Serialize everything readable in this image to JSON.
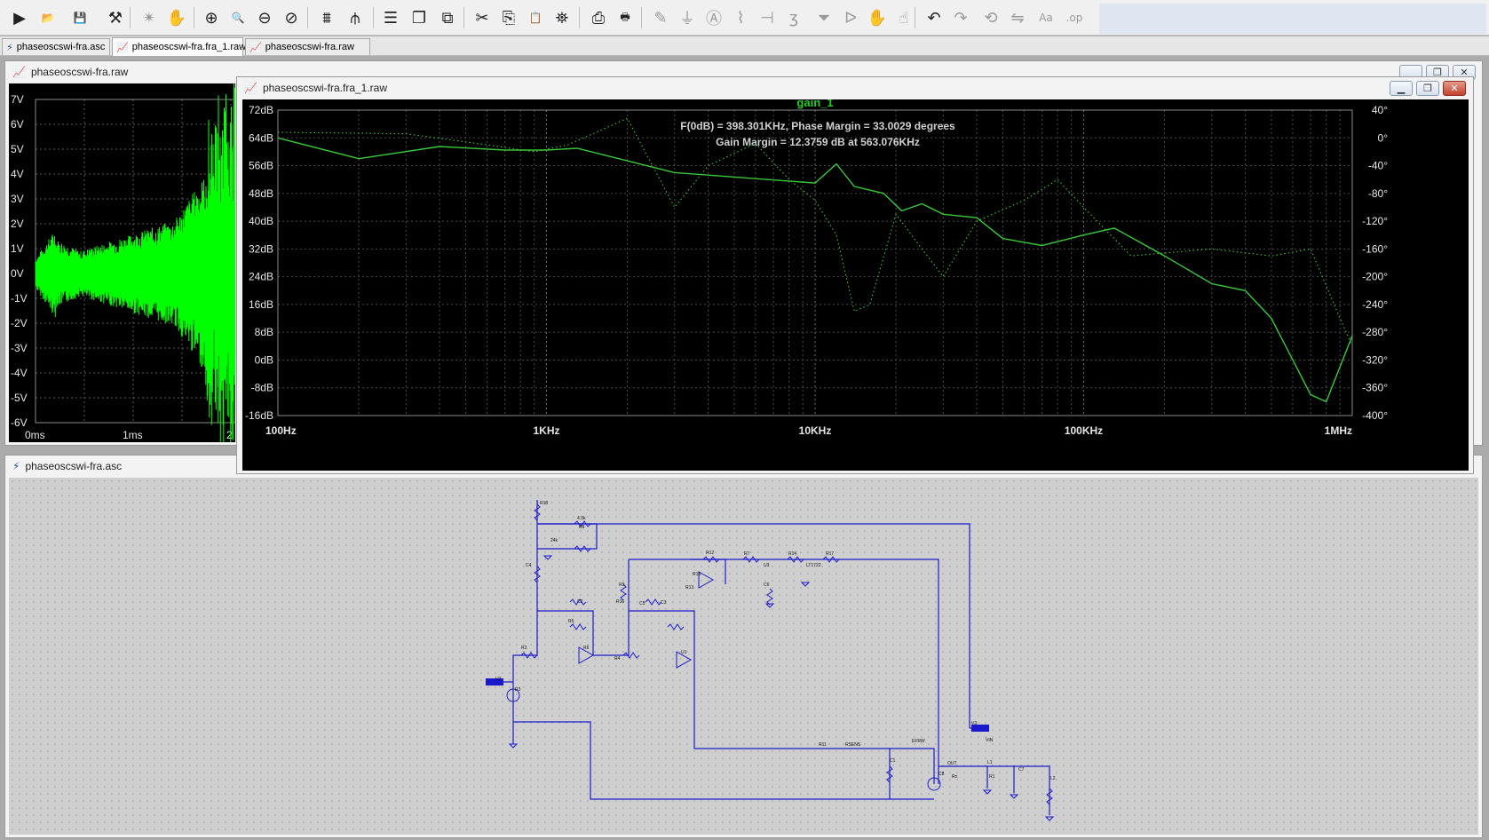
{
  "toolbar": {
    "buttons": [
      {
        "id": "run",
        "icon": "run-icon",
        "glyph": "▶",
        "x": 12,
        "enabled": true
      },
      {
        "id": "open",
        "icon": "open-folder-icon",
        "glyph": "📂",
        "x": 44,
        "enabled": true
      },
      {
        "id": "save",
        "icon": "save-icon",
        "glyph": "💾",
        "x": 80,
        "enabled": true
      },
      {
        "id": "control-panel",
        "icon": "hammer-icon",
        "glyph": "⚒",
        "x": 120,
        "enabled": true
      },
      {
        "id": "stop",
        "icon": "stop-running-icon",
        "glyph": "✴",
        "x": 158,
        "enabled": false
      },
      {
        "id": "pan",
        "icon": "pan-hand-icon",
        "glyph": "✋",
        "x": 189,
        "enabled": false
      },
      {
        "id": "zoom-in",
        "icon": "zoom-in-icon",
        "glyph": "⊕",
        "x": 228,
        "enabled": true
      },
      {
        "id": "zoom-area",
        "icon": "zoom-area-icon",
        "glyph": "🔍",
        "x": 258,
        "enabled": true
      },
      {
        "id": "zoom-out",
        "icon": "zoom-out-icon",
        "glyph": "⊖",
        "x": 288,
        "enabled": true
      },
      {
        "id": "zoom-fit",
        "icon": "zoom-fit-icon",
        "glyph": "⊘",
        "x": 318,
        "enabled": true
      },
      {
        "id": "autorange",
        "icon": "autorange-icon",
        "glyph": "⩩",
        "x": 358,
        "enabled": true
      },
      {
        "id": "add-trace",
        "icon": "add-trace-icon",
        "glyph": "⫛",
        "x": 390,
        "enabled": true
      },
      {
        "id": "tile-h",
        "icon": "tile-horizontal-icon",
        "glyph": "☰",
        "x": 430,
        "enabled": true
      },
      {
        "id": "cascade",
        "icon": "cascade-icon",
        "glyph": "❐",
        "x": 462,
        "enabled": true
      },
      {
        "id": "tile-v",
        "icon": "tile-vertical-icon",
        "glyph": "⧉",
        "x": 494,
        "enabled": true
      },
      {
        "id": "cut",
        "icon": "cut-icon",
        "glyph": "✂",
        "x": 533,
        "enabled": true
      },
      {
        "id": "copy",
        "icon": "copy-icon",
        "glyph": "⎘",
        "x": 563,
        "enabled": true
      },
      {
        "id": "paste",
        "icon": "paste-icon",
        "glyph": "📋",
        "x": 593,
        "enabled": true
      },
      {
        "id": "find",
        "icon": "find-binoculars-icon",
        "glyph": "⛯",
        "x": 623,
        "enabled": true
      },
      {
        "id": "print-setup",
        "icon": "print-setup-icon",
        "glyph": "⎙",
        "x": 664,
        "enabled": true
      },
      {
        "id": "print",
        "icon": "print-icon",
        "glyph": "🖶",
        "x": 694,
        "enabled": true
      },
      {
        "id": "draw-wire",
        "icon": "wire-pencil-icon",
        "glyph": "✎",
        "x": 734,
        "enabled": false
      },
      {
        "id": "ground",
        "icon": "ground-icon",
        "glyph": "⏚",
        "x": 764,
        "enabled": false
      },
      {
        "id": "label-net",
        "icon": "label-net-icon",
        "glyph": "Ⓐ",
        "x": 794,
        "enabled": false
      },
      {
        "id": "resistor",
        "icon": "resistor-icon",
        "glyph": "⌇",
        "x": 824,
        "enabled": false
      },
      {
        "id": "capacitor",
        "icon": "capacitor-icon",
        "glyph": "⊣",
        "x": 854,
        "enabled": false
      },
      {
        "id": "inductor",
        "icon": "inductor-icon",
        "glyph": "ʒ",
        "x": 884,
        "enabled": false
      },
      {
        "id": "diode",
        "icon": "diode-icon",
        "glyph": "⏷",
        "x": 918,
        "enabled": false
      },
      {
        "id": "component",
        "icon": "component-icon",
        "glyph": "ᐅ",
        "x": 948,
        "enabled": false
      },
      {
        "id": "move",
        "icon": "move-hand-icon",
        "glyph": "✋",
        "x": 978,
        "enabled": false
      },
      {
        "id": "drag",
        "icon": "drag-hand-icon",
        "glyph": "☝",
        "x": 1008,
        "enabled": false
      },
      {
        "id": "undo",
        "icon": "undo-icon",
        "glyph": "↶",
        "x": 1042,
        "enabled": true
      },
      {
        "id": "redo",
        "icon": "redo-icon",
        "glyph": "↷",
        "x": 1072,
        "enabled": false
      },
      {
        "id": "rotate",
        "icon": "rotate-icon",
        "glyph": "⟲",
        "x": 1106,
        "enabled": false
      },
      {
        "id": "mirror",
        "icon": "mirror-icon",
        "glyph": "⇋",
        "x": 1136,
        "enabled": false
      },
      {
        "id": "text",
        "icon": "text-icon",
        "glyph": "Aa",
        "x": 1168,
        "enabled": false
      },
      {
        "id": "spice-directive",
        "icon": "spice-directive-icon",
        "glyph": ".op",
        "x": 1200,
        "enabled": false
      }
    ],
    "separators": [
      146,
      218,
      346,
      420,
      522,
      652,
      722,
      1030
    ]
  },
  "tabs": [
    {
      "label": "phaseoscswi-fra.asc",
      "icon": "schematic-icon",
      "kind": "s",
      "active": false
    },
    {
      "label": "phaseoscswi-fra.fra_1.raw",
      "icon": "waveform-icon",
      "kind": "w",
      "active": true
    },
    {
      "label": "phaseoscswi-fra.raw",
      "icon": "waveform-icon",
      "kind": "w",
      "active": false
    }
  ],
  "windows": {
    "transient": {
      "title": "phaseoscswi-fra.raw"
    },
    "bode": {
      "title": "phaseoscswi-fra.fra_1.raw"
    },
    "schematic": {
      "title": "phaseoscswi-fra.asc"
    }
  },
  "transient_chart": {
    "type": "line",
    "ylabels": [
      "7V",
      "6V",
      "5V",
      "4V",
      "3V",
      "2V",
      "1V",
      "0V",
      "-1V",
      "-2V",
      "-3V",
      "-4V",
      "-5V",
      "-6V"
    ],
    "xlabels": [
      "0ms",
      "1ms",
      "2"
    ],
    "ylim": [
      -6,
      7
    ],
    "trace_color": "#00ff00"
  },
  "chart_data": {
    "type": "line",
    "title": "gain_1",
    "annotations": [
      "F(0dB) = 398.301KHz, Phase Margin = 33.0029 degrees",
      "Gain Margin = 12.3759 dB at 563.076KHz"
    ],
    "xscale": "log",
    "xlim": [
      100,
      1000000
    ],
    "xticks": [
      "100Hz",
      "1KHz",
      "10KHz",
      "100KHz",
      "1MHz"
    ],
    "ylim_left": [
      -16,
      72
    ],
    "yticks_left": [
      "72dB",
      "64dB",
      "56dB",
      "48dB",
      "40dB",
      "32dB",
      "24dB",
      "16dB",
      "8dB",
      "0dB",
      "-8dB",
      "-16dB"
    ],
    "ylim_right": [
      -400,
      40
    ],
    "yticks_right": [
      "40°",
      "0°",
      "-40°",
      "-80°",
      "-120°",
      "-160°",
      "-200°",
      "-240°",
      "-280°",
      "-320°",
      "-360°",
      "-400°"
    ],
    "grid": true,
    "series": [
      {
        "role": "magnitude",
        "axis": "left",
        "style": "solid",
        "color": "#38c838",
        "x": [
          100,
          200,
          400,
          700,
          1000,
          1300,
          3000,
          10000,
          12000,
          14000,
          18000,
          21000,
          25000,
          30000,
          40000,
          50000,
          70000,
          100000,
          130000,
          200000,
          300000,
          400000,
          500000,
          700000,
          800000,
          1000000
        ],
        "y": [
          64,
          58,
          61.5,
          60.5,
          60.5,
          61,
          54,
          51,
          56.5,
          50,
          48,
          43,
          45,
          42,
          41,
          35,
          33,
          36,
          38,
          30,
          22,
          20,
          12,
          -10,
          -12,
          7
        ]
      },
      {
        "role": "phase",
        "axis": "right",
        "style": "dotted",
        "color": "#38c838",
        "x": [
          100,
          300,
          600,
          900,
          1200,
          2000,
          3000,
          4000,
          6000,
          8000,
          10000,
          12000,
          14000,
          16000,
          20000,
          25000,
          30000,
          40000,
          60000,
          80000,
          100000,
          150000,
          300000,
          500000,
          700000,
          900000,
          1000000
        ],
        "y": [
          8,
          6,
          -10,
          -20,
          -10,
          28,
          -100,
          -40,
          -8,
          -60,
          -90,
          -140,
          -250,
          -240,
          -110,
          -160,
          -200,
          -120,
          -90,
          -60,
          -100,
          -170,
          -160,
          -170,
          -160,
          -260,
          -300
        ]
      }
    ]
  },
  "schematic": {
    "labels": [
      "R18",
      "4.3k",
      "R8",
      "24k",
      "C4",
      "R9",
      "R12",
      "R7",
      "R14",
      "R17",
      "R15",
      "R13",
      "U3",
      "LT1722",
      "C6",
      "C5",
      "R16",
      "C2",
      "C3",
      "R5",
      "R2",
      "R6",
      "R4",
      "U1",
      "R3",
      "U2",
      "V3",
      "VIN",
      "OUT",
      "Rn",
      "L1",
      "R1",
      "C7",
      "L2",
      "C1",
      "C8",
      "R11",
      "RSENS",
      "EFRW",
      "A",
      "B",
      "A2"
    ]
  }
}
